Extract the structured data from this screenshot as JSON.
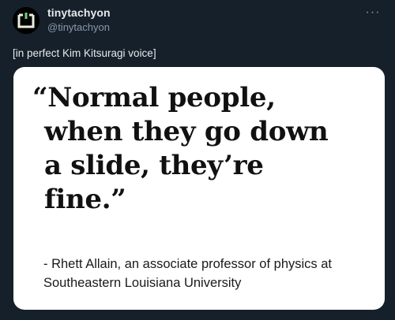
{
  "tweet": {
    "author": {
      "display_name": "tinytachyon",
      "handle": "@tinytachyon"
    },
    "more_label": "···",
    "text": "[in perfect Kim Kitsuragi voice]",
    "media": {
      "quote_lines": [
        "“Normal people,",
        "when they go down",
        "a slide, they’re",
        "fine.”"
      ],
      "attribution_lines": [
        "- Rhett Allain, an associate professor of physics at",
        "Southeastern Louisiana University"
      ]
    }
  }
}
